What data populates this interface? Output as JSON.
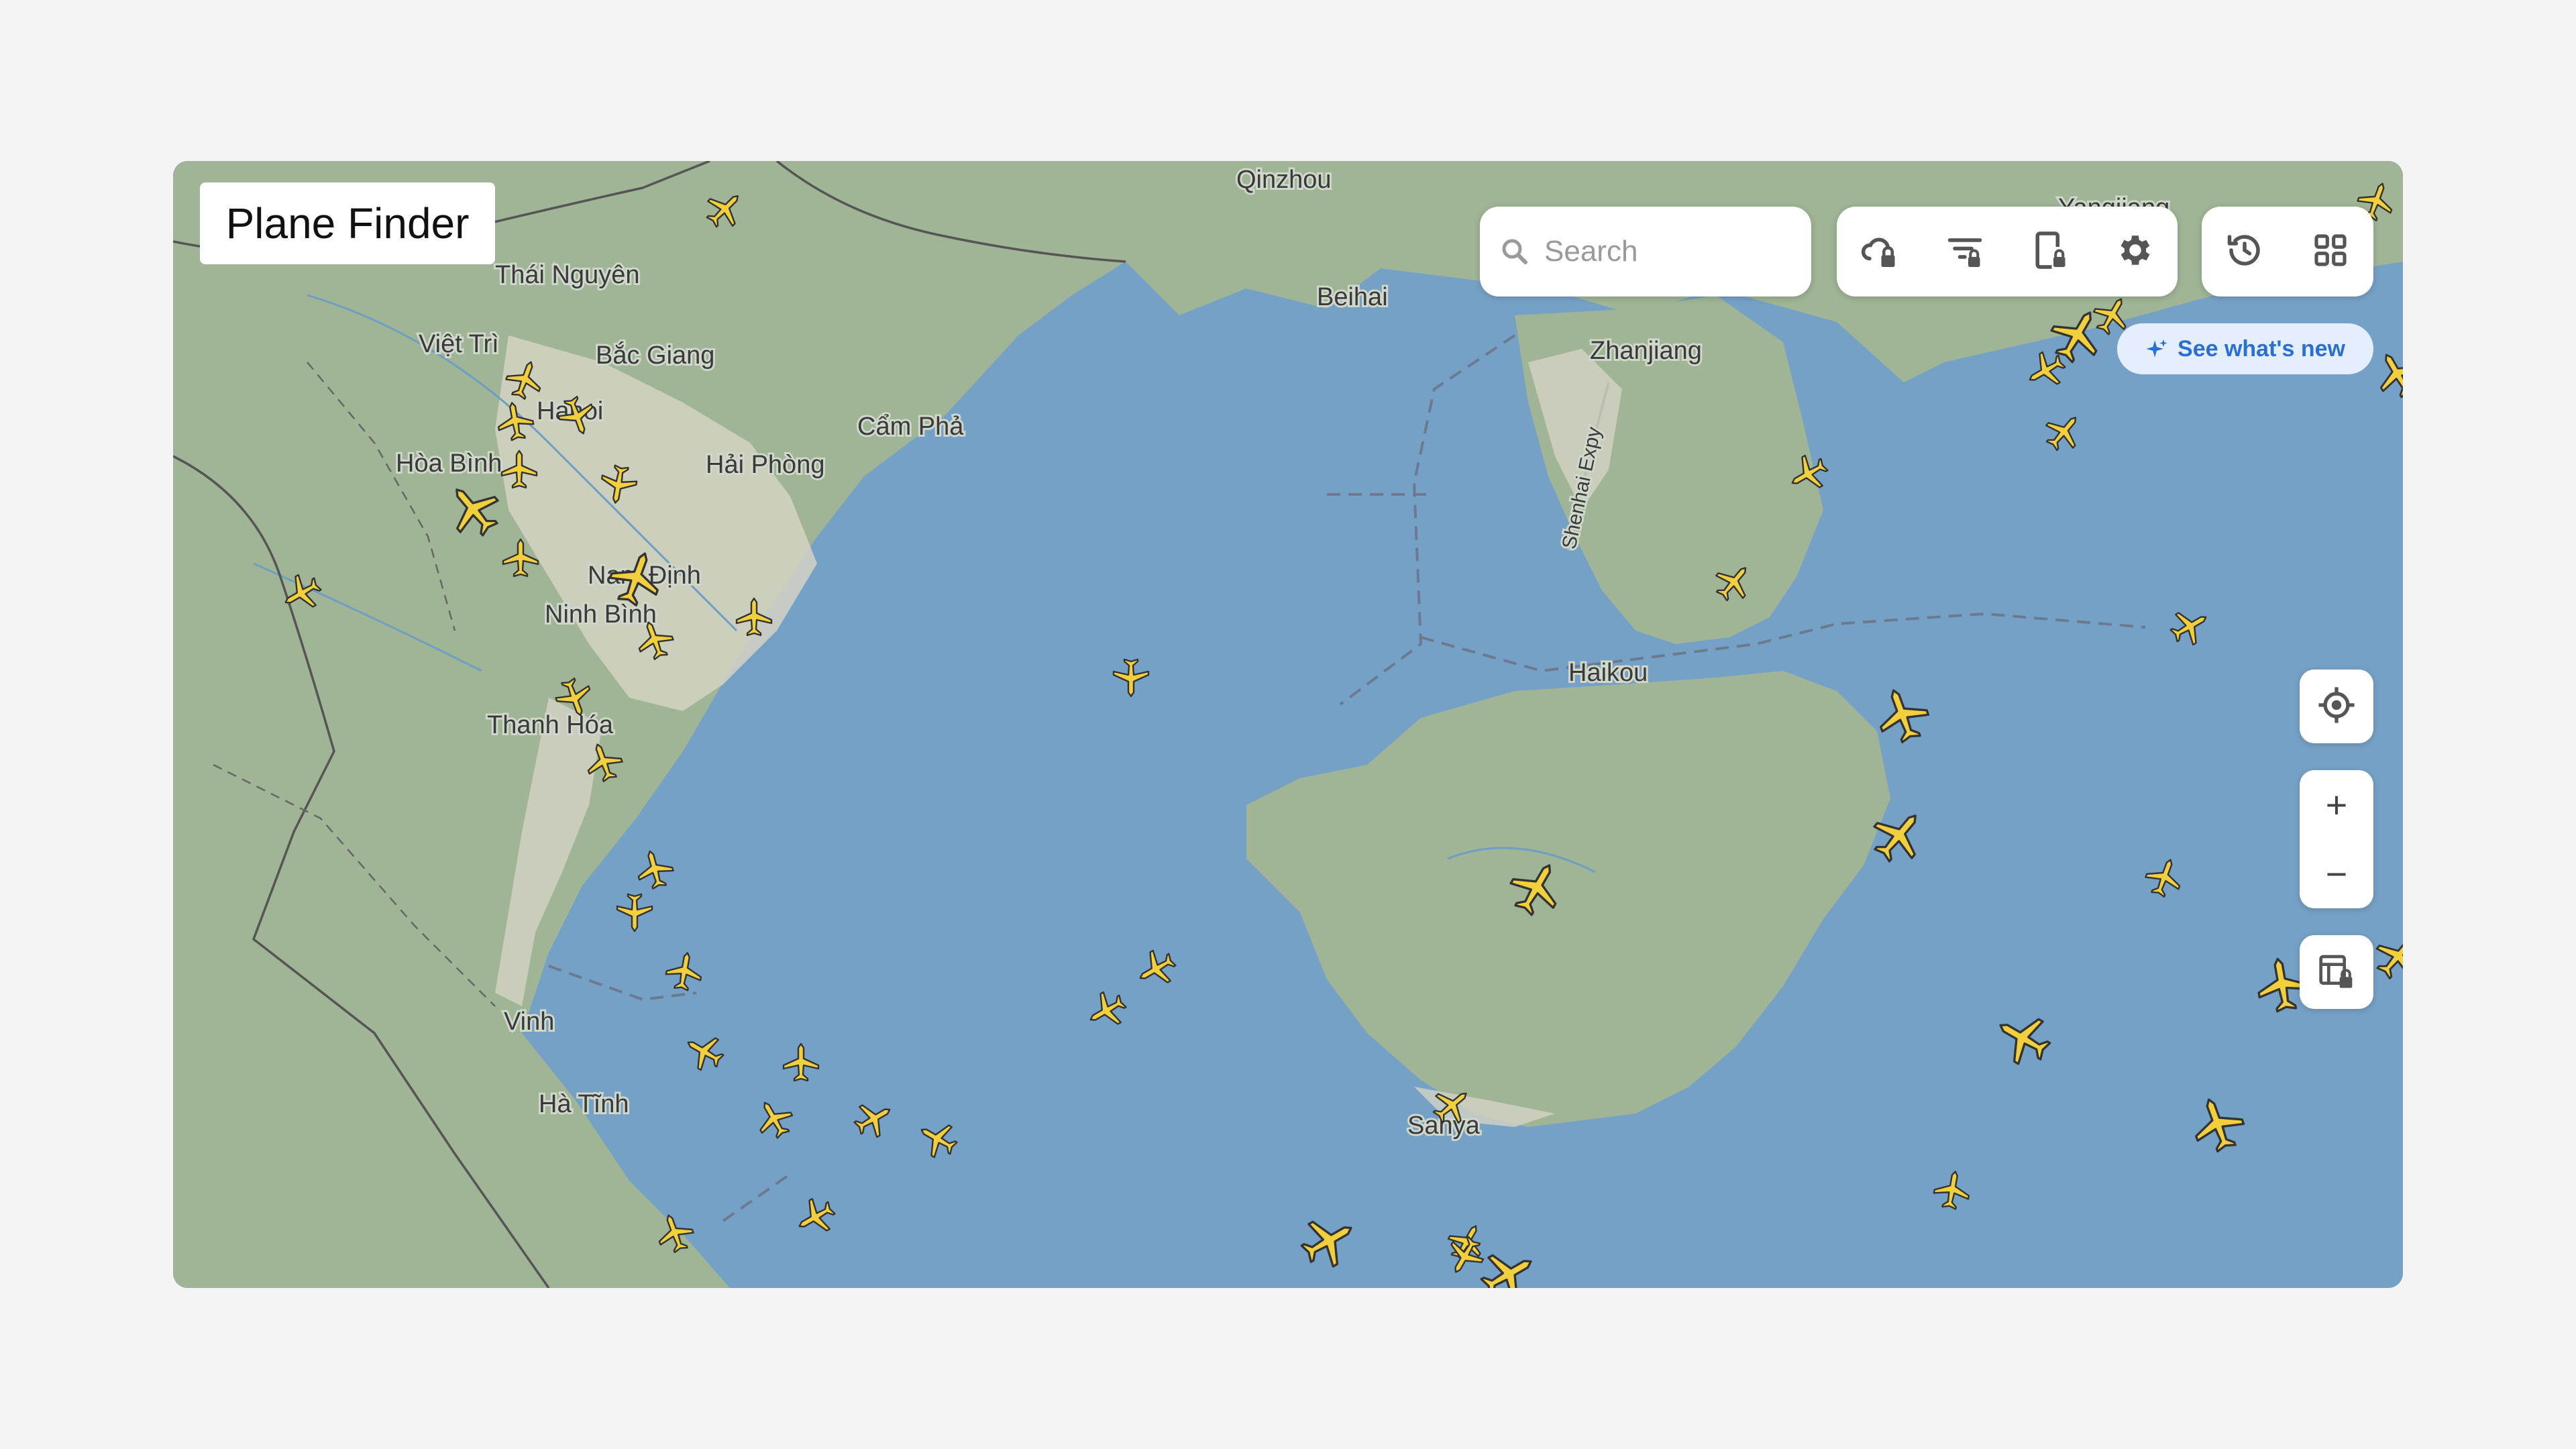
{
  "app_title": "Plane Finder",
  "search": {
    "placeholder": "Search"
  },
  "toolbar_primary": [
    {
      "icon": "weather-lock-icon"
    },
    {
      "icon": "filter-lock-icon"
    },
    {
      "icon": "device-lock-icon"
    },
    {
      "icon": "gear-icon"
    }
  ],
  "toolbar_secondary": [
    {
      "icon": "history-icon"
    },
    {
      "icon": "grid-menu-icon"
    }
  ],
  "whats_new_label": "See what's new",
  "map_controls": {
    "locate": "locate-icon",
    "zoom_in": "+",
    "zoom_out": "−",
    "layers": "layers-lock-icon"
  },
  "map_labels": {
    "qinzhou": "Qinzhou",
    "thai_nguyen": "Thái Nguyên",
    "viet_tri": "Việt Trì",
    "bac_giang": "Bắc Giang",
    "hanoi": "Hanoi",
    "hoa_binh": "Hòa Bình",
    "hai_phong": "Hải Phòng",
    "cam_pha": "Cẩm Phả",
    "beihai": "Beihai",
    "zhanjiang": "Zhanjiang",
    "yangjiang": "Yangjiang",
    "nam_dinh": "Nam Định",
    "ninh_binh": "Ninh Bình",
    "thanh_hoa": "Thanh Hóa",
    "haikou": "Haikou",
    "vinh": "Vinh",
    "ha_tinh": "Hà Tĩnh",
    "sanya": "Sanya",
    "expressway": "Shenhai Expy"
  },
  "colors": {
    "sea": "#76a1c6",
    "land": "#9fb595",
    "urban": "#d5d3c4",
    "plane": "#f2cf3c",
    "accent": "#2a6fd6"
  }
}
